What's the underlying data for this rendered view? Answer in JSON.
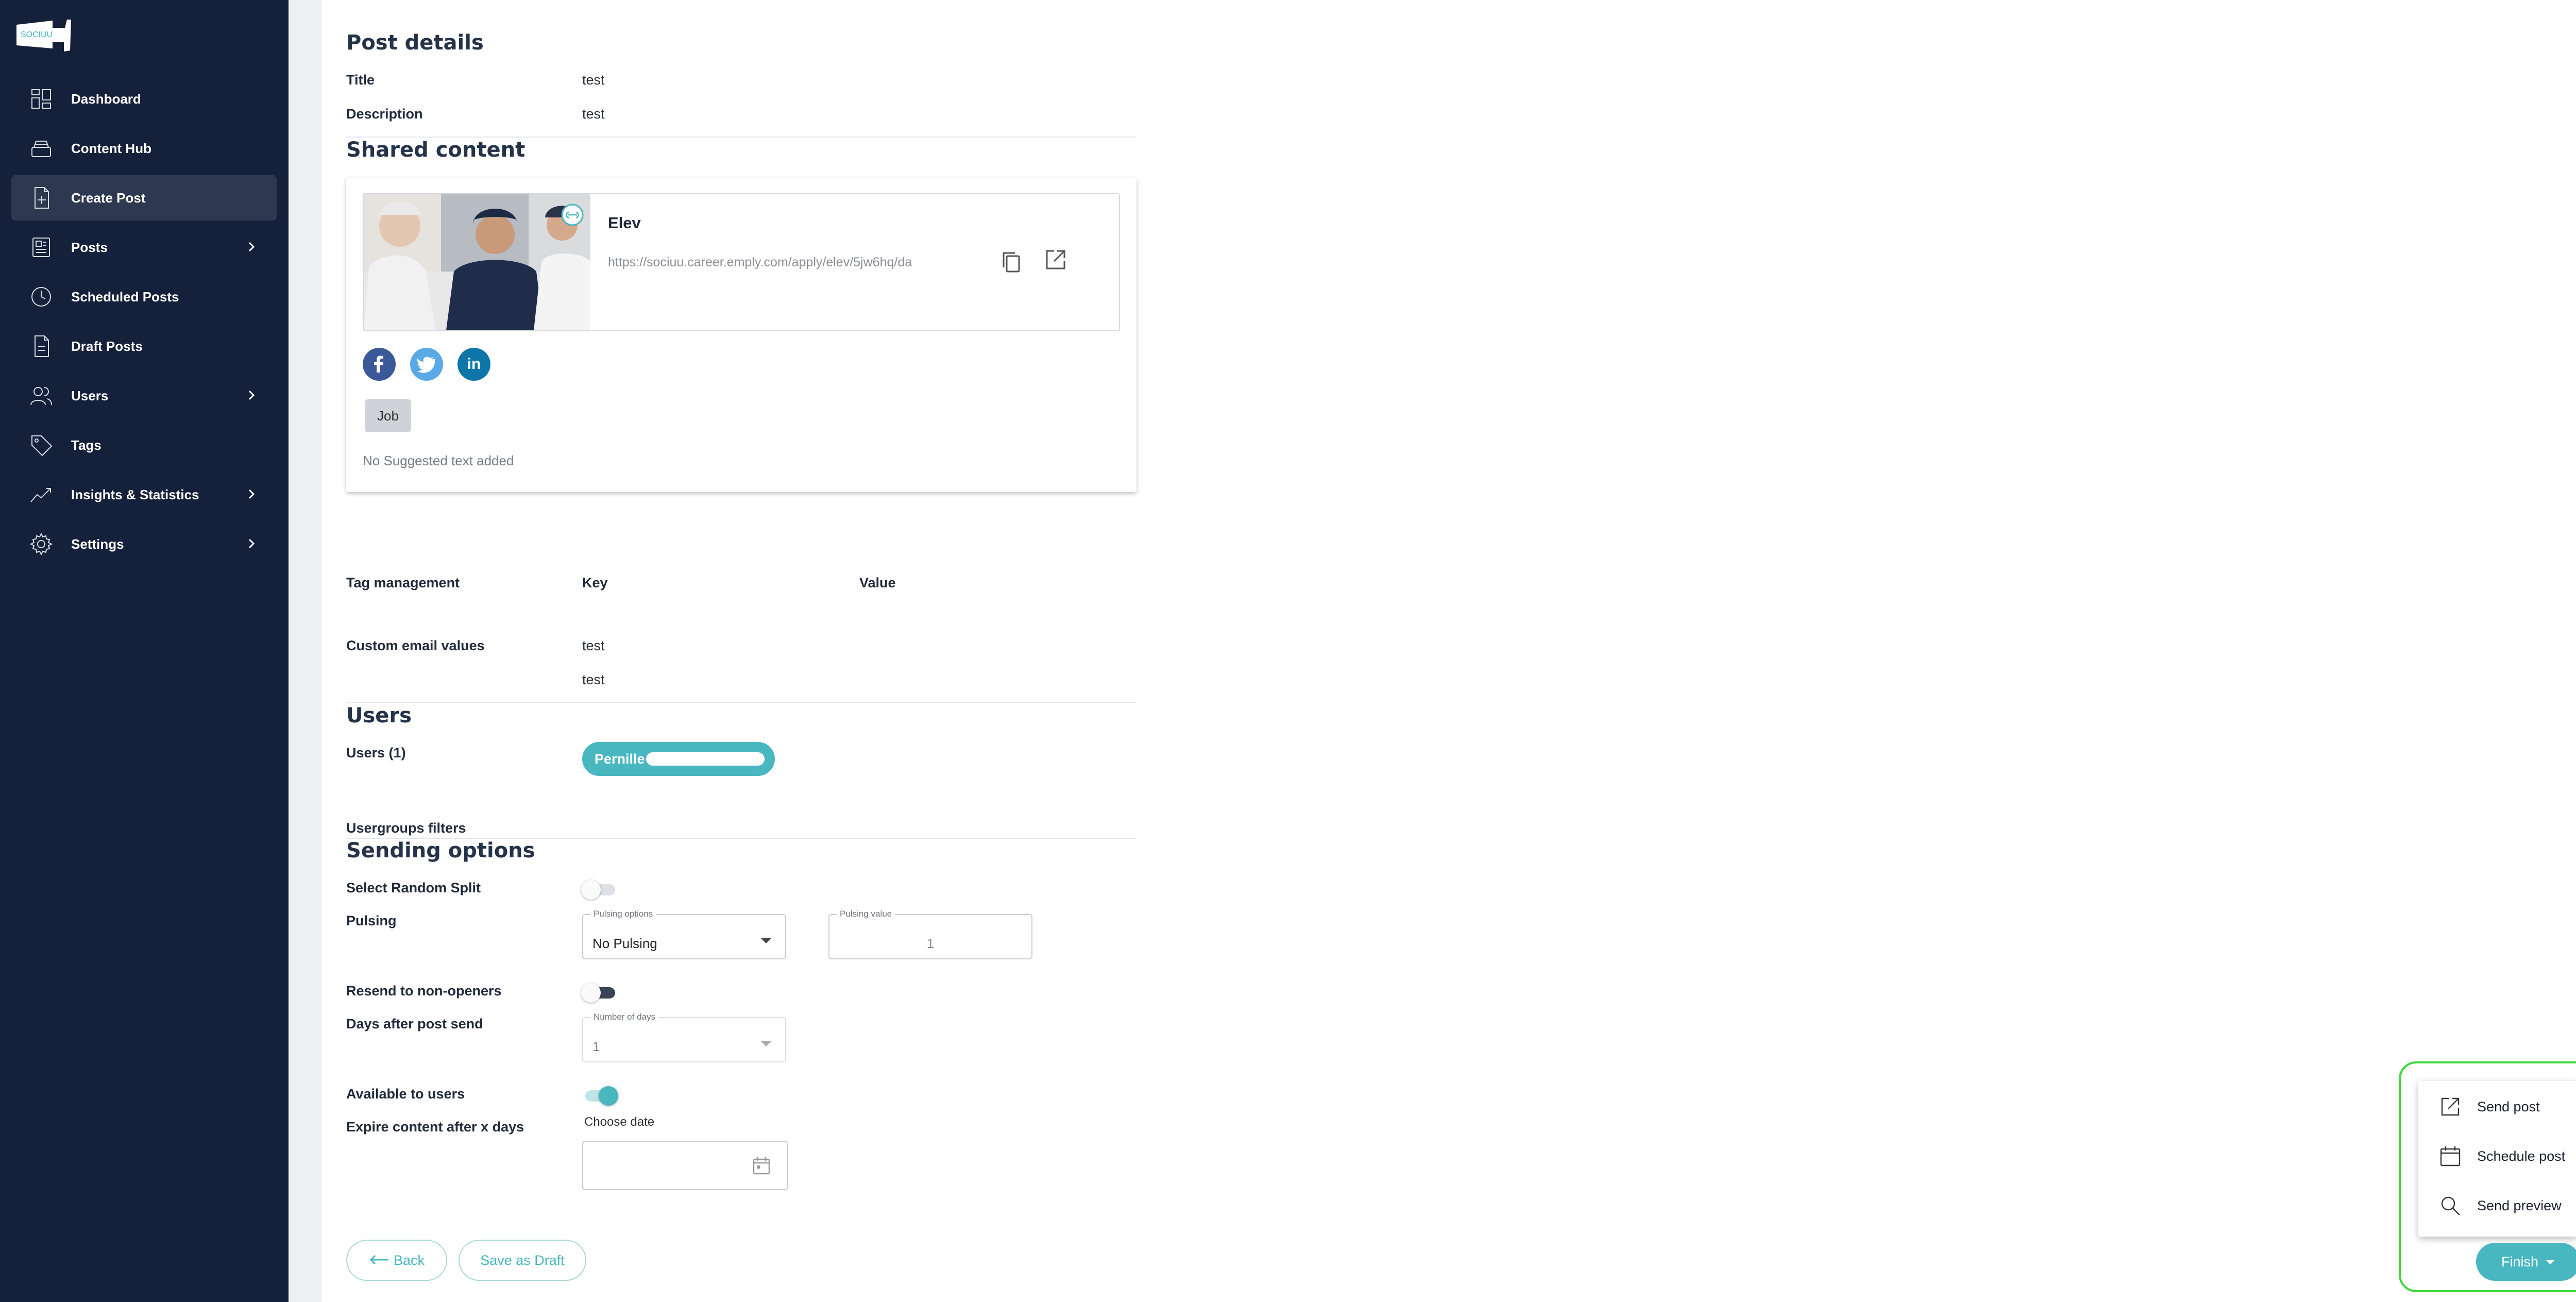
{
  "sidebar": {
    "logo_text": "SOCIUU",
    "items": [
      {
        "label": "Dashboard",
        "icon": "dashboard-icon"
      },
      {
        "label": "Content Hub",
        "icon": "stack-icon"
      },
      {
        "label": "Create Post",
        "icon": "file-plus-icon",
        "active": true
      },
      {
        "label": "Posts",
        "icon": "newspaper-icon",
        "expandable": true
      },
      {
        "label": "Scheduled Posts",
        "icon": "clock-icon"
      },
      {
        "label": "Draft Posts",
        "icon": "document-icon"
      },
      {
        "label": "Users",
        "icon": "users-icon",
        "expandable": true
      },
      {
        "label": "Tags",
        "icon": "tag-icon"
      },
      {
        "label": "Insights & Statistics",
        "icon": "trend-icon",
        "expandable": true
      },
      {
        "label": "Settings",
        "icon": "gear-icon",
        "expandable": true
      }
    ]
  },
  "post_details": {
    "heading": "Post details",
    "title_label": "Title",
    "title_value": "test",
    "description_label": "Description",
    "description_value": "test"
  },
  "shared_content": {
    "heading": "Shared content",
    "link_title": "Elev",
    "link_url": "https://sociuu.career.emply.com/apply/elev/5jw6hq/da",
    "tag": "Job",
    "suggested_text": "No Suggested text added",
    "socials": [
      "facebook",
      "twitter",
      "linkedin"
    ]
  },
  "tag_management": {
    "label": "Tag management",
    "key_header": "Key",
    "value_header": "Value"
  },
  "custom_email": {
    "label": "Custom email values",
    "values": [
      "test",
      "test"
    ]
  },
  "users": {
    "heading": "Users",
    "count_label": "Users (1)",
    "chip_name": "Pernille",
    "usergroups_label": "Usergroups filters"
  },
  "sending_options": {
    "heading": "Sending options",
    "random_split_label": "Select Random Split",
    "pulsing_label": "Pulsing",
    "pulsing_options_label": "Pulsing options",
    "pulsing_options_value": "No Pulsing",
    "pulsing_value_label": "Pulsing value",
    "pulsing_value": "1",
    "resend_label": "Resend to non-openers",
    "days_label": "Days after post send",
    "days_field_label": "Number of days",
    "days_value": "1",
    "available_label": "Available to users",
    "expire_label": "Expire content after x days",
    "choose_date_label": "Choose date"
  },
  "footer": {
    "back_label": "Back",
    "draft_label": "Save as Draft",
    "finish_label": "Finish"
  },
  "finish_menu": {
    "items": [
      {
        "label": "Send post",
        "icon": "external-link-icon"
      },
      {
        "label": "Schedule post",
        "icon": "calendar-icon"
      },
      {
        "label": "Send preview",
        "icon": "search-icon"
      }
    ]
  },
  "colors": {
    "sidebar_bg": "#15213b",
    "accent": "#48b7c0",
    "highlight_outline": "#3ed63a"
  }
}
